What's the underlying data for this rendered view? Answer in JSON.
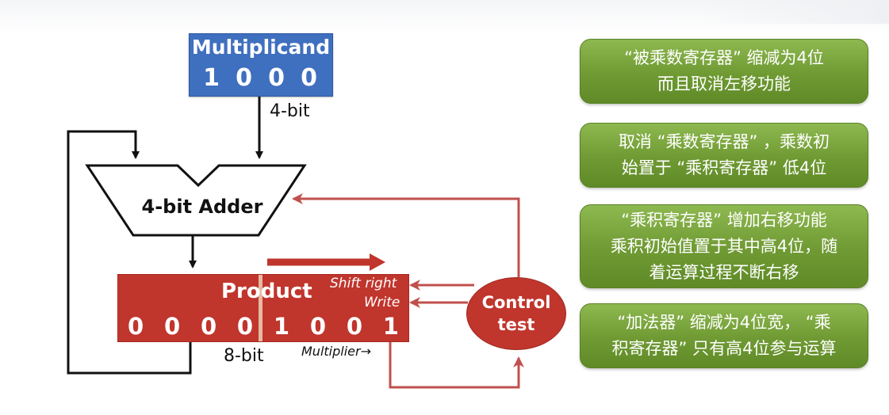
{
  "multiplicand": {
    "title": "Multiplicand",
    "bits": [
      "1",
      "0",
      "0",
      "0"
    ],
    "width_label": "4-bit"
  },
  "adder": {
    "label": "4-bit Adder"
  },
  "product": {
    "title": "Product",
    "bits": [
      "0",
      "0",
      "0",
      "0",
      "1",
      "0",
      "0",
      "1"
    ],
    "width_label": "8-bit",
    "shift_label": "Shift right",
    "write_label": "Write",
    "multiplier_label": "Multiplier→"
  },
  "control": {
    "line1": "Control",
    "line2": "test"
  },
  "notes": [
    {
      "lines": [
        "“被乘数寄存器” 缩减为4位",
        "而且取消左移功能"
      ]
    },
    {
      "lines": [
        "取消 “乘数寄存器” ，乘数初",
        "始置于 “乘积寄存器” 低4位"
      ]
    },
    {
      "lines": [
        "“乘积寄存器” 增加右移功能",
        "乘积初始值置于其中高4位，随",
        "着运算过程不断右移"
      ]
    },
    {
      "lines": [
        "“加法器” 缩减为4位宽， “乘",
        "积寄存器” 只有高4位参与运算"
      ]
    }
  ],
  "colors": {
    "multiplicand_fill": "#3f6fbf",
    "product_fill": "#c0352c",
    "control_fill": "#c0352c",
    "control_arrow": "#c0504d",
    "note_fill": "#7aa63d"
  }
}
